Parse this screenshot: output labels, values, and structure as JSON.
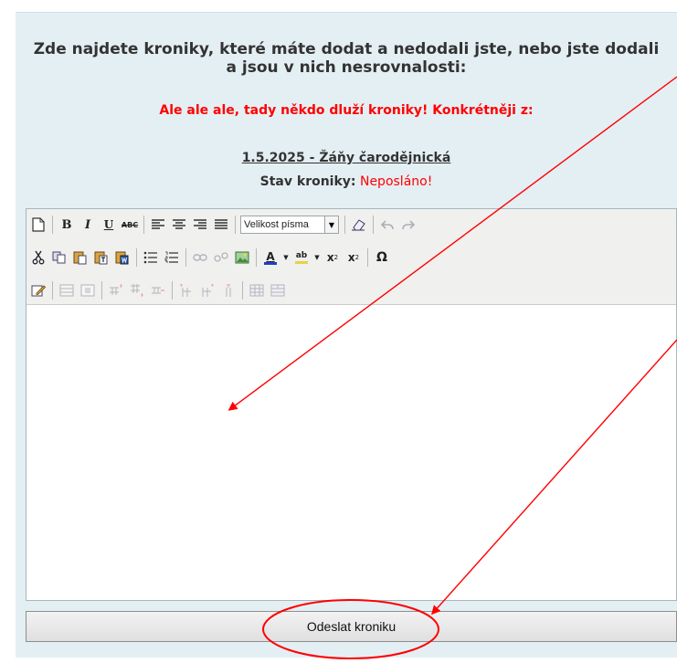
{
  "heading": {
    "line1": "Zde najdete kroniky, které máte dodat a nedodali jste, nebo jste dodali",
    "line2": "a jsou v nich nesrovnalosti:"
  },
  "alert": "Ale ale ale, tady někdo dluží kroniky! Konkrétněji z:",
  "chronicle": {
    "link": "1.5.2025 - Žáňy čarodějnická",
    "status_label": "Stav kroniky:",
    "status_value": "Neposláno!"
  },
  "editor": {
    "font_size_select": "Velikost písma"
  },
  "submit_label": "Odeslat kroniku",
  "colors": {
    "panel_bg": "#e4eff4",
    "alert_red": "#ff0000",
    "annotation_red": "#ff0000"
  }
}
